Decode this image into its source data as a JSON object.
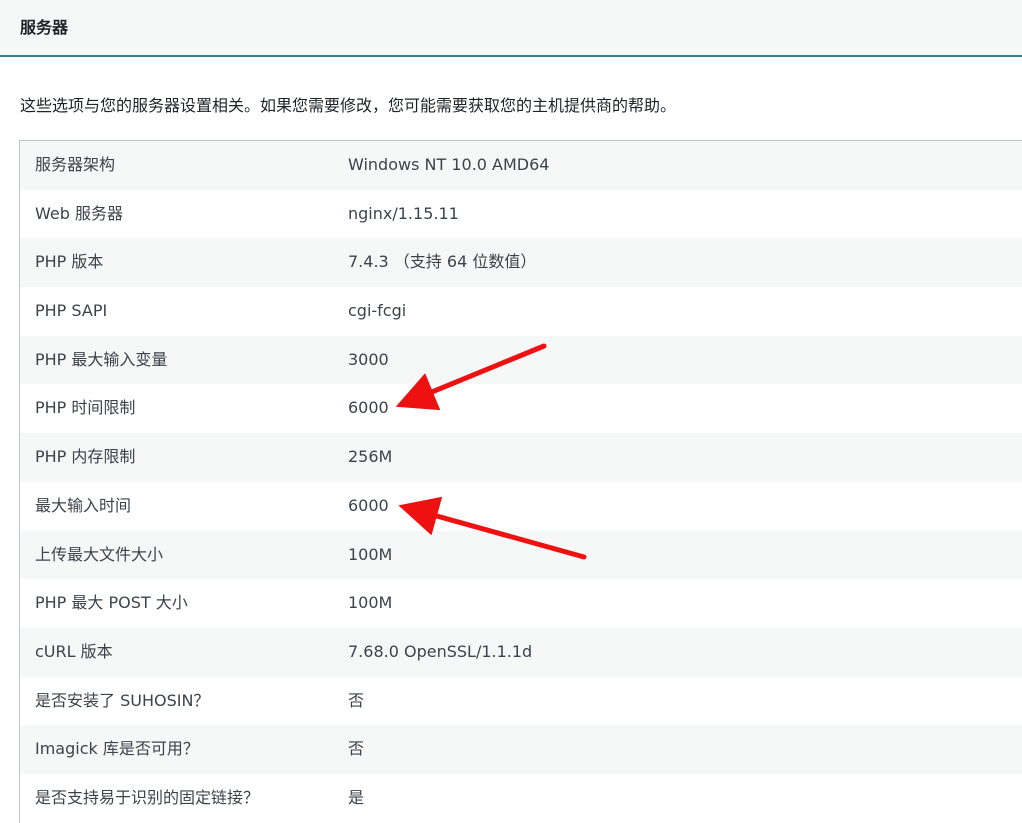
{
  "section": {
    "title": "服务器",
    "description": "这些选项与您的服务器设置相关。如果您需要修改，您可能需要获取您的主机提供商的帮助。"
  },
  "rows": [
    {
      "label": "服务器架构",
      "value": "Windows NT 10.0 AMD64"
    },
    {
      "label": "Web 服务器",
      "value": "nginx/1.15.11"
    },
    {
      "label": "PHP 版本",
      "value": "7.4.3 （支持 64 位数值）"
    },
    {
      "label": "PHP SAPI",
      "value": "cgi-fcgi"
    },
    {
      "label": "PHP 最大输入变量",
      "value": "3000"
    },
    {
      "label": "PHP 时间限制",
      "value": "6000"
    },
    {
      "label": "PHP 内存限制",
      "value": "256M"
    },
    {
      "label": "最大输入时间",
      "value": "6000"
    },
    {
      "label": "上传最大文件大小",
      "value": "100M"
    },
    {
      "label": "PHP 最大 POST 大小",
      "value": "100M"
    },
    {
      "label": "cURL 版本",
      "value": "7.68.0 OpenSSL/1.1.1d"
    },
    {
      "label": "是否安装了 SUHOSIN？",
      "value": "否"
    },
    {
      "label": "Imagick 库是否可用？",
      "value": "否"
    },
    {
      "label": "是否支持易于识别的固定链接？",
      "value": "是"
    }
  ],
  "colors": {
    "annotation_arrow": "#ee1111",
    "header_border": "#2f7f8f",
    "striped_row": "#f6f7f7"
  }
}
